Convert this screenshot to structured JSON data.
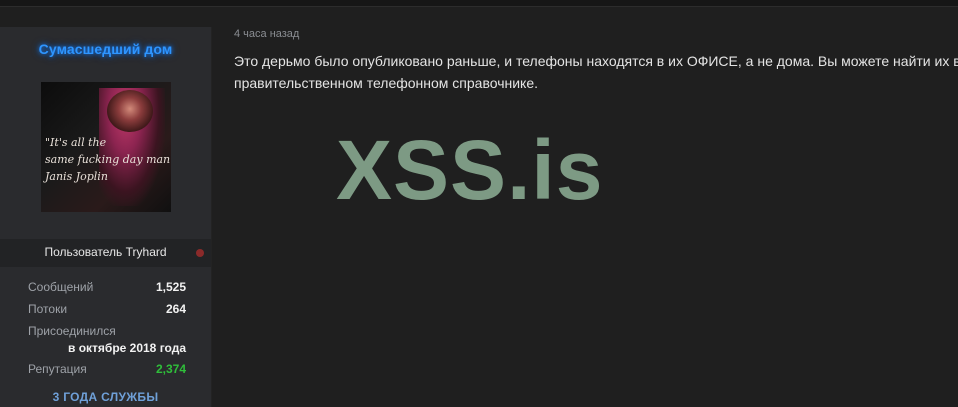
{
  "user": {
    "name": "Сумасшедший дом",
    "title": "Пользователь Tryhard",
    "avatar_caption": [
      "\"It's all the",
      "same fucking day man...\"",
      "Janis Joplin"
    ],
    "stats": {
      "messages_label": "Сообщений",
      "messages_value": "1,525",
      "threads_label": "Потоки",
      "threads_value": "264",
      "joined_label": "Присоединился",
      "joined_value": "в октябре 2018 года",
      "reputation_label": "Репутация",
      "reputation_value": "2,374"
    },
    "service_badge": "3 ГОДА СЛУЖБЫ",
    "colors": {
      "name": "#2e95ff",
      "reputation": "#2fbf3a",
      "status_dot": "#8b2a2a"
    }
  },
  "post": {
    "time": "4 часа назад",
    "lines": [
      "Это дерьмо было опубликовано раньше, и телефоны находятся в их ОФИСЕ, а не дома. Вы можете найти их в",
      "правительственном телефонном справочнике."
    ]
  },
  "watermark": {
    "text": "XSS.is",
    "color": "#7d9a84"
  }
}
